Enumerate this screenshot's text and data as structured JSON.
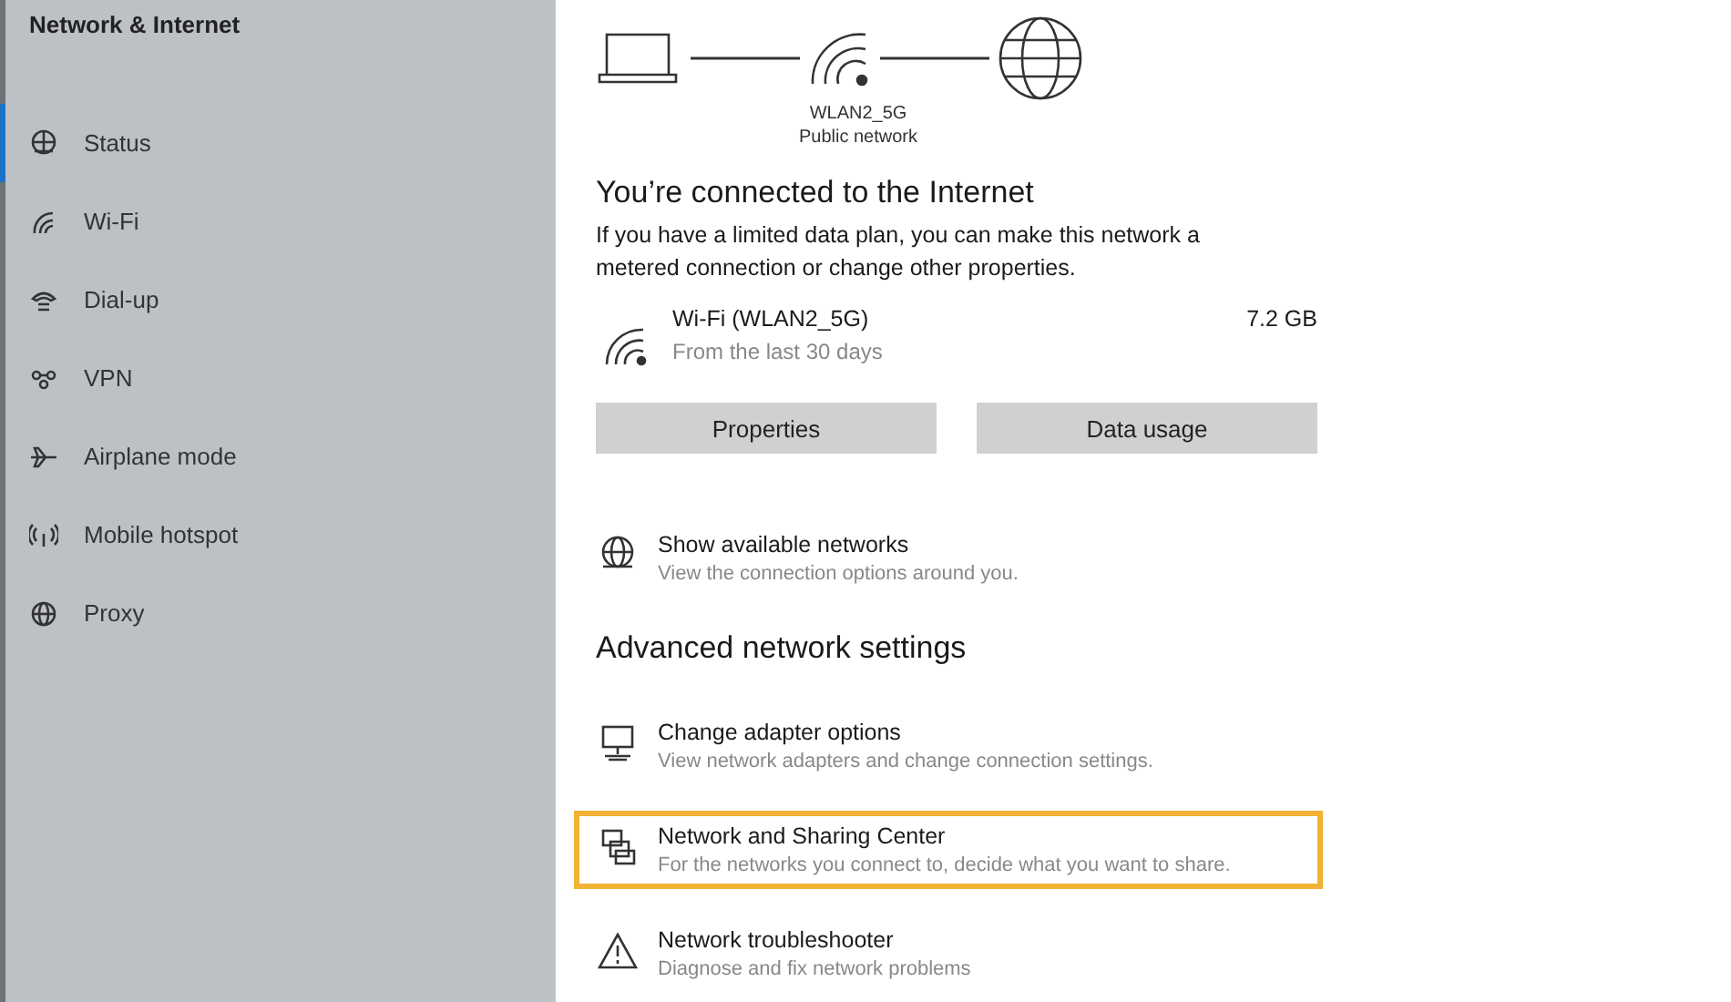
{
  "sidebar": {
    "title": "Network & Internet",
    "items": [
      {
        "label": "Status",
        "kind": "status",
        "selected": true
      },
      {
        "label": "Wi-Fi",
        "kind": "wifi",
        "selected": false
      },
      {
        "label": "Dial-up",
        "kind": "dialup",
        "selected": false
      },
      {
        "label": "VPN",
        "kind": "vpn",
        "selected": false
      },
      {
        "label": "Airplane mode",
        "kind": "airplane",
        "selected": false
      },
      {
        "label": "Mobile hotspot",
        "kind": "hotspot",
        "selected": false
      },
      {
        "label": "Proxy",
        "kind": "proxy",
        "selected": false
      }
    ]
  },
  "diagram": {
    "network_name": "WLAN2_5G",
    "network_type": "Public network"
  },
  "status": {
    "heading": "You’re connected to the Internet",
    "description": "If you have a limited data plan, you can make this network a metered connection or change other properties."
  },
  "connection": {
    "name": "Wi-Fi (WLAN2_5G)",
    "period": "From the last 30 days",
    "usage": "7.2 GB"
  },
  "buttons": [
    "Properties",
    "Data usage"
  ],
  "show_networks": {
    "title": "Show available networks",
    "description": "View the connection options around you.",
    "kind": "networks"
  },
  "advanced": {
    "heading": "Advanced network settings",
    "items": [
      {
        "title": "Change adapter options",
        "description": "View network adapters and change connection settings.",
        "kind": "adapter",
        "highlighted": false
      },
      {
        "title": "Network and Sharing Center",
        "description": "For the networks you connect to, decide what you want to share.",
        "kind": "sharing",
        "highlighted": true
      },
      {
        "title": "Network troubleshooter",
        "description": "Diagnose and fix network problems",
        "kind": "warning",
        "highlighted": false
      }
    ]
  }
}
